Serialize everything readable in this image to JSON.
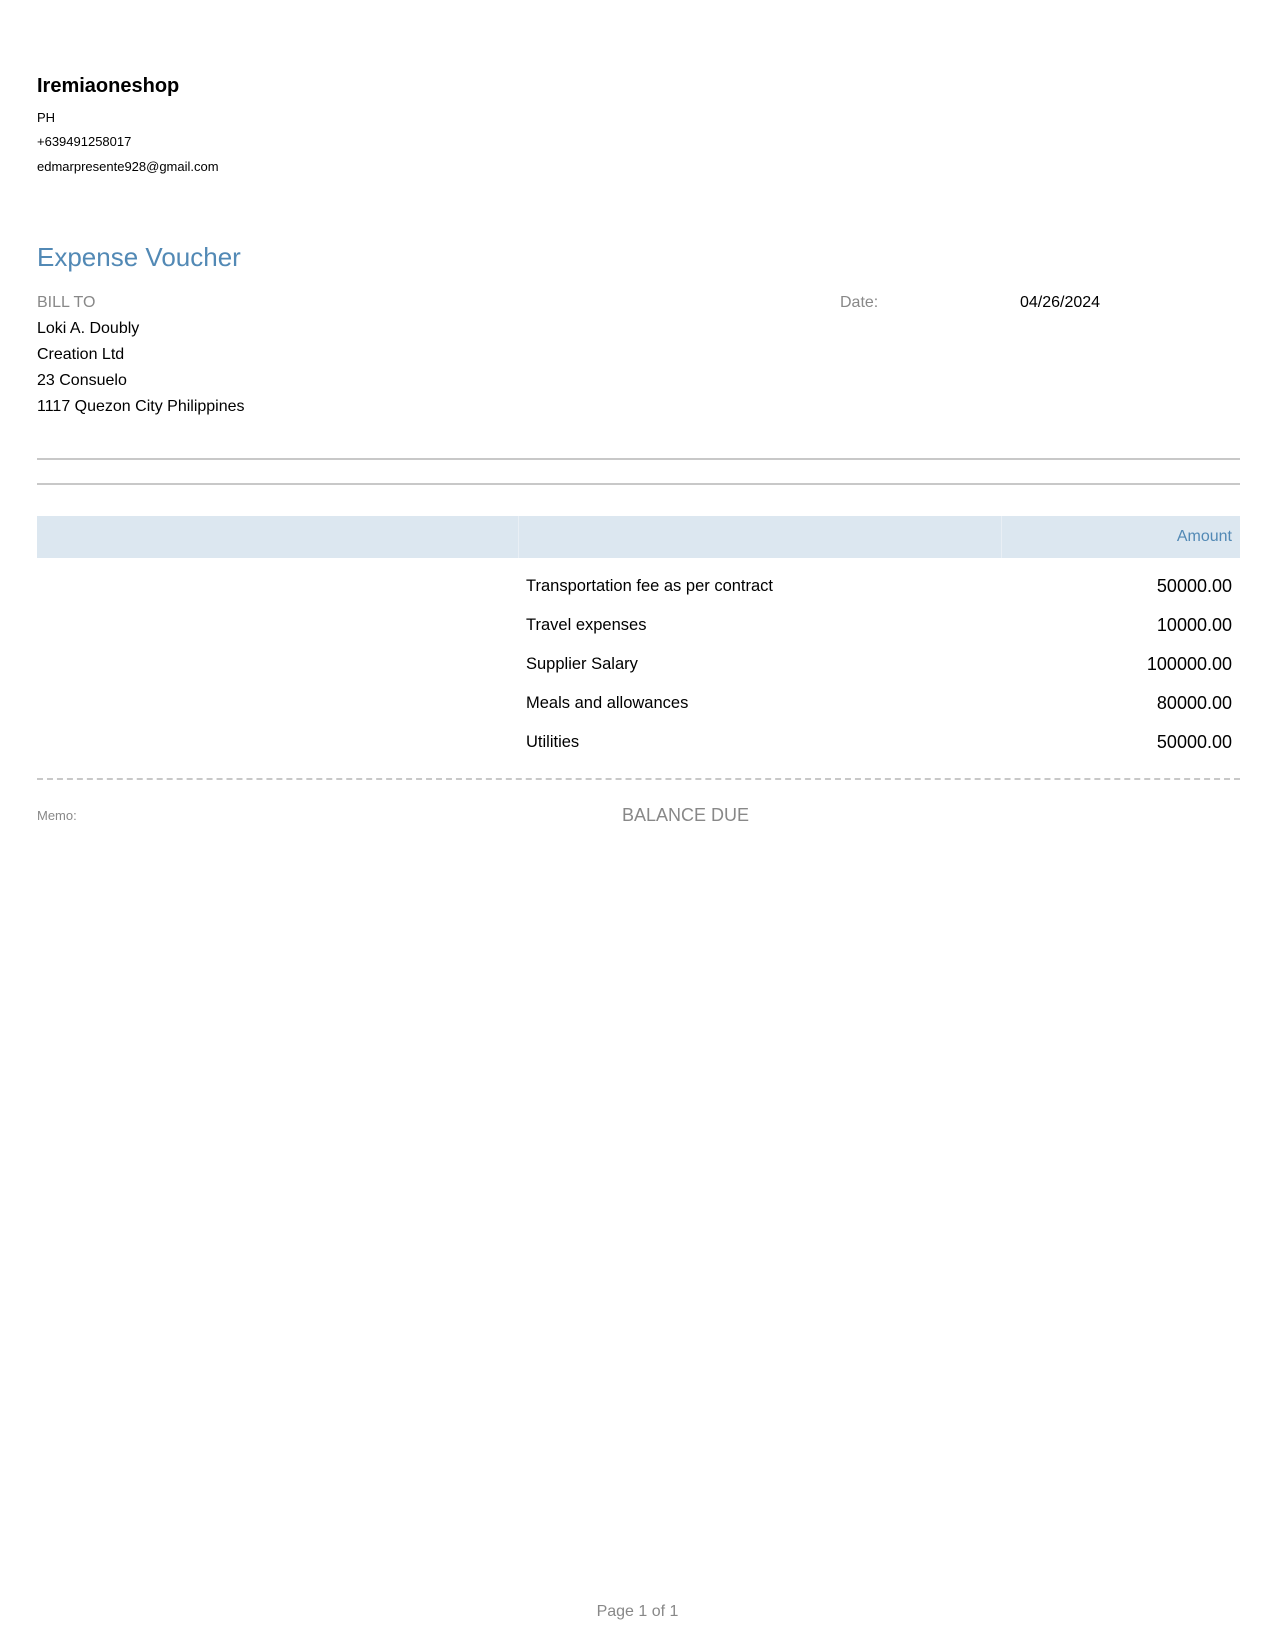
{
  "company": {
    "name": "Iremiaoneshop",
    "country": "PH",
    "phone": "+639491258017",
    "email": "edmarpresente928@gmail.com"
  },
  "document": {
    "title": "Expense Voucher"
  },
  "bill_to": {
    "label": "BILL TO",
    "lines": [
      "Loki A. Doubly",
      "Creation Ltd",
      "23 Consuelo",
      "1117 Quezon City Philippines"
    ]
  },
  "date": {
    "label": "Date:",
    "value": "04/26/2024"
  },
  "table": {
    "amount_header": "Amount",
    "items": [
      {
        "description": "Transportation fee as per contract",
        "amount": "50000.00"
      },
      {
        "description": "Travel expenses",
        "amount": "10000.00"
      },
      {
        "description": "Supplier Salary",
        "amount": "100000.00"
      },
      {
        "description": "Meals and allowances",
        "amount": "80000.00"
      },
      {
        "description": "Utilities",
        "amount": "50000.00"
      }
    ]
  },
  "summary": {
    "memo_label": "Memo:",
    "balance_due_label": "BALANCE DUE"
  },
  "footer": {
    "page_label": "Page 1 of 1"
  },
  "colors": {
    "accent": "#5289b5",
    "header_fill": "#dce7f0",
    "muted_text": "#888888",
    "rule": "#c8c8c8"
  }
}
